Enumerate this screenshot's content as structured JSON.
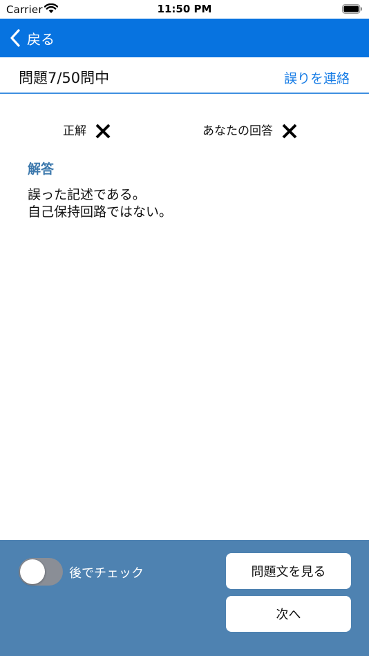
{
  "status_bar": {
    "carrier": "Carrier",
    "time": "11:50 PM"
  },
  "nav": {
    "back_label": "戻る",
    "bar_color": "#0773e0"
  },
  "question": {
    "counter": "問題7/50問中",
    "report_link": "誤りを連絡"
  },
  "result": {
    "correct_label": "正解",
    "correct_mark": "x-icon",
    "your_answer_label": "あなたの回答",
    "your_answer_mark": "x-icon"
  },
  "answer": {
    "heading": "解答",
    "body": "誤った記述である。\n自己保持回路ではない。",
    "heading_color": "#3d79ad"
  },
  "footer": {
    "toggle_label": "後でチェック",
    "toggle_on": false,
    "view_question_button": "問題文を見る",
    "next_button": "次へ",
    "background_color": "#4e82b1"
  }
}
